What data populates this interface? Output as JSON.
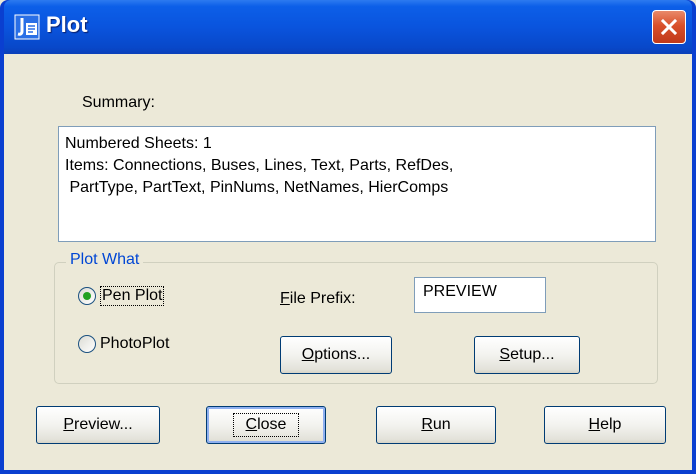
{
  "window": {
    "title": "Plot",
    "app_icon": "plot-app-icon",
    "close_icon": "close-icon"
  },
  "summary": {
    "label": "Summary:",
    "lines": [
      "Numbered Sheets: 1",
      "Items:  Connections, Buses, Lines, Text, Parts, RefDes,",
      " PartType, PartText, PinNums, NetNames, HierComps"
    ]
  },
  "plot_what": {
    "legend": "Plot What",
    "options": [
      {
        "label": "Pen Plot",
        "checked": true
      },
      {
        "label": "PhotoPlot",
        "checked": false
      }
    ],
    "file_prefix_label_pre": "",
    "file_prefix_label_ul": "F",
    "file_prefix_label_post": "ile Prefix:",
    "file_prefix_value": "PREVIEW",
    "options_button": {
      "ul": "O",
      "rest": "ptions..."
    },
    "setup_button": {
      "ul": "S",
      "rest": "etup..."
    }
  },
  "bottom_buttons": {
    "preview": {
      "ul": "P",
      "rest": "review..."
    },
    "close": {
      "ul": "C",
      "rest": "lose"
    },
    "run": {
      "ul": "R",
      "rest": "un"
    },
    "help": {
      "ul": "H",
      "rest": "elp"
    }
  },
  "colors": {
    "titlebar": "#0a54de",
    "group_legend": "#0046d5",
    "radio_dot": "#21a121",
    "close_button": "#d9502a"
  }
}
